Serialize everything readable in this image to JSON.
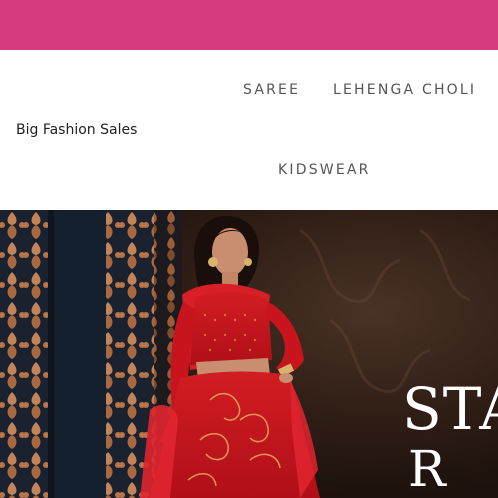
{
  "site": {
    "brand": "Big Fashion Sales"
  },
  "nav": {
    "items": [
      {
        "label": "SAREE"
      },
      {
        "label": "LEHENGA CHOLI"
      },
      {
        "label": "KIDSWEAR"
      }
    ]
  },
  "hero": {
    "line1": "STA",
    "line2": "R"
  },
  "colors": {
    "top_bar": "#d63b7f",
    "nav_text": "#555555",
    "hero_dress": "#c8141c",
    "hero_background": "#2a1a14",
    "hero_screen": "#c4845a"
  }
}
